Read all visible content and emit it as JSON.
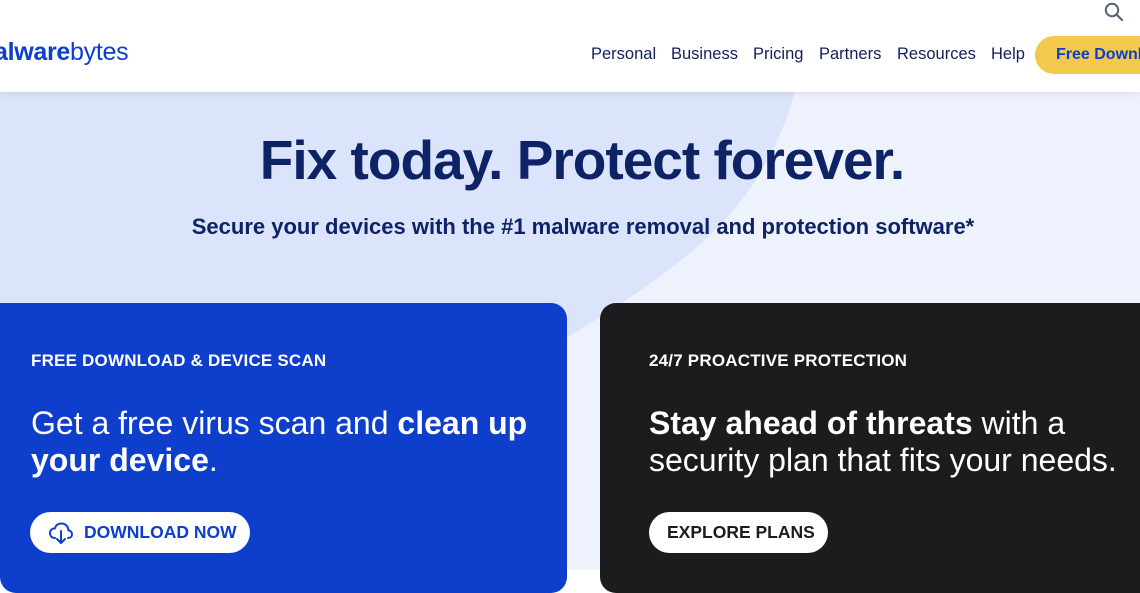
{
  "brand": {
    "logo_strong": "alware",
    "logo_light": "bytes",
    "logo_prefix": "",
    "accent": "#0d3ecc",
    "cta_color": "#f2c94c",
    "dark_card": "#1c1c1e"
  },
  "nav": {
    "items": [
      {
        "label": "Personal"
      },
      {
        "label": "Business"
      },
      {
        "label": "Pricing"
      },
      {
        "label": "Partners"
      },
      {
        "label": "Resources"
      },
      {
        "label": "Help"
      }
    ],
    "cta_label": "Free Download"
  },
  "hero": {
    "title": "Fix today. Protect forever.",
    "subtitle": "Secure your devices with the #1 malware removal and protection software*"
  },
  "cards": [
    {
      "eyebrow": "FREE DOWNLOAD & DEVICE SCAN",
      "heading_light_1": "Get a free virus scan and ",
      "heading_bold": "clean up your device",
      "heading_light_2": ".",
      "button_label": "DOWNLOAD NOW",
      "icon": "download-cloud-icon"
    },
    {
      "eyebrow": "24/7 PROACTIVE PROTECTION",
      "heading_bold": "Stay ahead of threats",
      "heading_light": " with a security plan that fits your needs.",
      "button_label": "EXPLORE PLANS"
    }
  ]
}
